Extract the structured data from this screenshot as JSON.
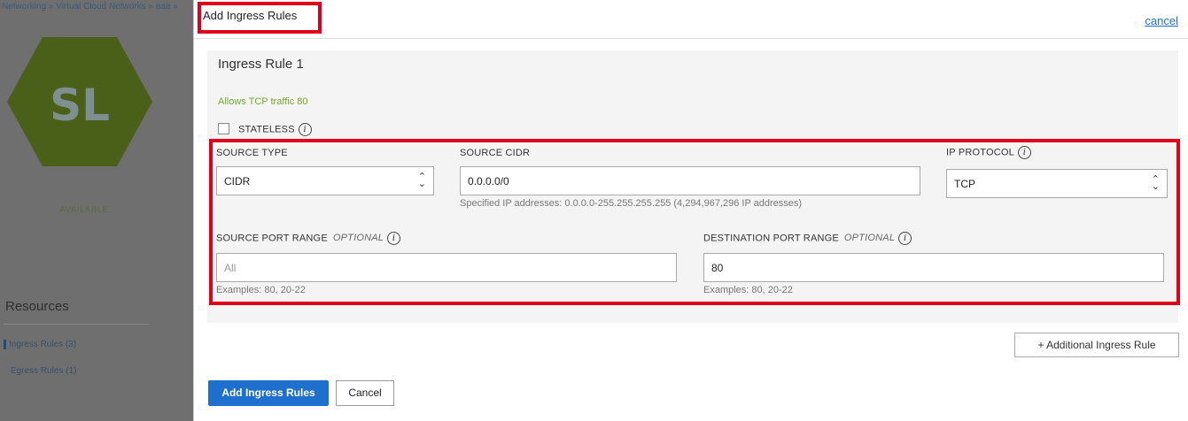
{
  "background": {
    "breadcrumb": "Networking » Virtual Cloud Networks » aaa »",
    "avatar_text": "SL",
    "status": "AVAILABLE",
    "resources_title": "Resources",
    "resource_items": [
      {
        "label": "Ingress Rules (3)"
      },
      {
        "label": "Egress Rules (1)"
      }
    ]
  },
  "dialog": {
    "title": "Add Ingress Rules",
    "cancel_link": "cancel",
    "rule": {
      "heading": "Ingress Rule 1",
      "description": "Allows TCP traffic 80",
      "stateless_label": "STATELESS",
      "source_type": {
        "label": "SOURCE TYPE",
        "value": "CIDR"
      },
      "source_cidr": {
        "label": "SOURCE CIDR",
        "value": "0.0.0.0/0",
        "hint": "Specified IP addresses: 0.0.0.0-255.255.255.255 (4,294,967,296 IP addresses)"
      },
      "ip_protocol": {
        "label": "IP PROTOCOL",
        "value": "TCP"
      },
      "source_port_range": {
        "label": "SOURCE PORT RANGE",
        "optional": "OPTIONAL",
        "placeholder": "All",
        "hint": "Examples: 80, 20-22"
      },
      "destination_port_range": {
        "label": "DESTINATION PORT RANGE",
        "optional": "OPTIONAL",
        "value": "80",
        "hint": "Examples: 80, 20-22"
      }
    },
    "additional_rule_button": "+ Additional Ingress Rule",
    "submit_button": "Add Ingress Rules",
    "cancel_button": "Cancel"
  },
  "colors": {
    "accent": "#1f6fcf",
    "highlight": "#e0001a",
    "description": "#7aa52a",
    "hexagon": "#5a7a1a"
  },
  "icons": {
    "info": "info-icon",
    "select_chevron": "chevron-up-down-icon"
  }
}
